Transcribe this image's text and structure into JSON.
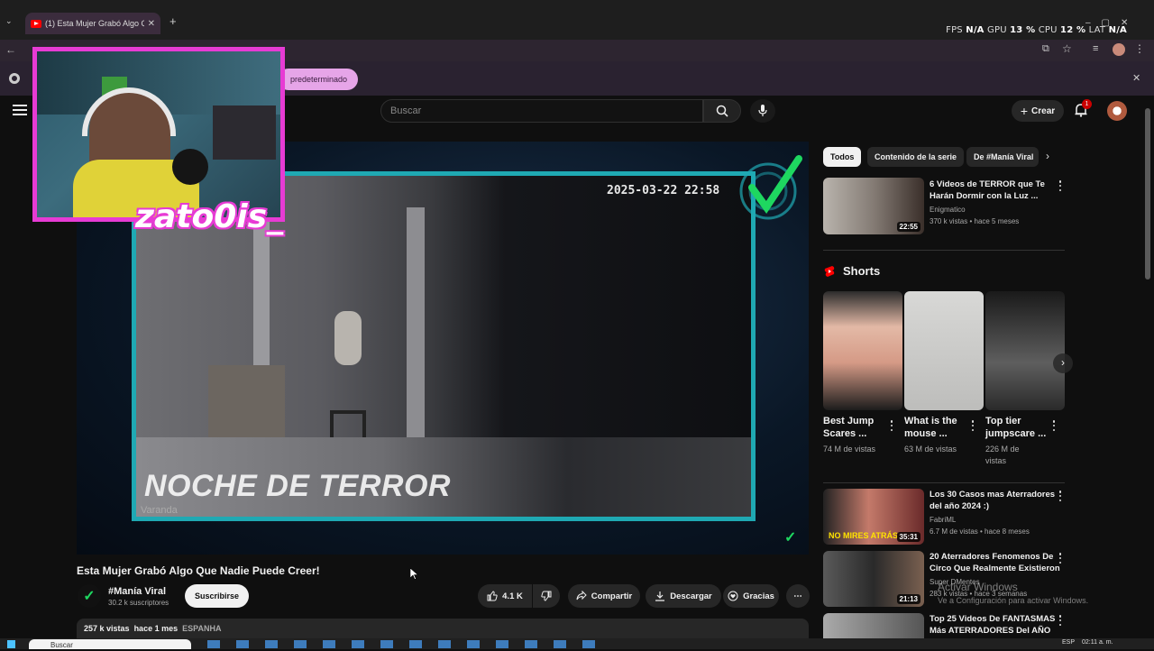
{
  "browser": {
    "tab_title": "(1) Esta Mujer Grabó Algo Q",
    "perf": {
      "fps_label": "FPS",
      "fps_val": "N/A",
      "gpu_label": "GPU",
      "gpu_val": "13 %",
      "cpu_label": "CPU",
      "cpu_val": "12 %",
      "lat_label": "LAT",
      "lat_val": "N/A"
    },
    "infobar_text": "predeterminado"
  },
  "header": {
    "search_placeholder": "Buscar",
    "create_label": "Crear",
    "notif_count": "1"
  },
  "video": {
    "timestamp": "2025-03-22  22:58",
    "overlay_title": "NOCHE DE TERROR",
    "camera_label": "Varanda",
    "streamer_name": "zato0is_",
    "title": "Esta Mujer Grabó Algo Que Nadie Puede Creer!",
    "channel": "#Manía Viral",
    "subscribers": "30.2 k suscriptores",
    "subscribe_label": "Suscribirse",
    "likes": "4.1 K",
    "share_label": "Compartir",
    "download_label": "Descargar",
    "thanks_label": "Gracias",
    "views": "257 k vistas",
    "age": "hace 1 mes",
    "tag": "ESPANHA"
  },
  "sidebar": {
    "chips": [
      "Todos",
      "Contenido de la serie",
      "De #Manía Viral"
    ],
    "rec_top": {
      "title1": "6 Videos de TERROR que Te",
      "title2": "Harán Dormir con la Luz ...",
      "channel": "Enigmatico",
      "meta": "370 k vistas • hace 5 meses",
      "duration": "22:55"
    },
    "shorts_heading": "Shorts",
    "shorts": [
      {
        "title1": "Best Jump",
        "title2": "Scares ...",
        "meta1": "74 M de vistas",
        "meta2": ""
      },
      {
        "title1": "What is the",
        "title2": "mouse ...",
        "meta1": "63 M de vistas",
        "meta2": ""
      },
      {
        "title1": "Top tier",
        "title2": "jumpscare ...",
        "meta1": "226 M de",
        "meta2": "vistas"
      }
    ],
    "recs": [
      {
        "title1": "Los 30 Casos mas Aterradores",
        "title2": "del año 2024 :)",
        "channel": "FabriML",
        "meta": "6.7 M de vistas • hace 8 meses",
        "duration": "35:31",
        "badge": "NO MIRES ATRÁS"
      },
      {
        "title1": "20 Aterradores Fenomenos De",
        "title2": "Circo Que Realmente Existieron",
        "channel": "Super DMentes",
        "meta": "283 k vistas • hace 3 semanas",
        "duration": "21:13"
      },
      {
        "title1": "Top 25 Videos De FANTASMAS",
        "title2": "Más ATERRADORES Del AÑO",
        "channel": "",
        "meta": "",
        "duration": ""
      }
    ]
  },
  "watermark": {
    "line1": "Activar Windows",
    "line2": "Ve a Configuración para activar Windows."
  },
  "taskbar": {
    "search": "Buscar",
    "time": "02:11 a. m.",
    "lang": "ESP"
  },
  "colors": {
    "accent_pink": "#e73bd4",
    "frame_teal": "#1fa9b3",
    "yt_red": "#ff0000",
    "check_green": "#1ed760"
  }
}
